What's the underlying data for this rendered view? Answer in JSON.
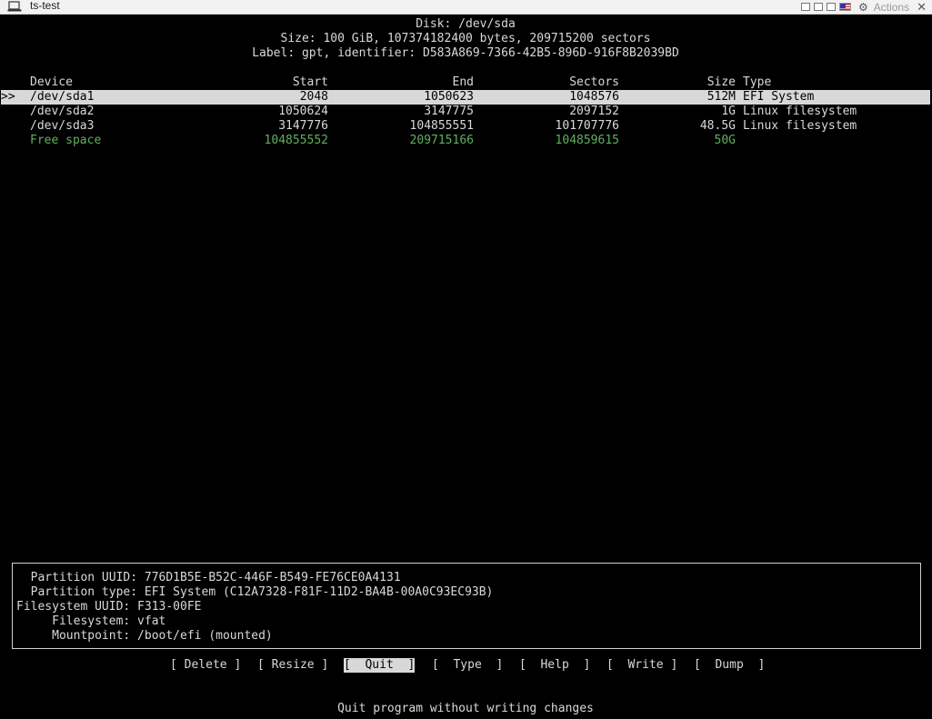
{
  "window": {
    "title": "ts-test",
    "actions_label": "Actions",
    "close_label": "✕"
  },
  "header": {
    "disk": "Disk: /dev/sda",
    "size": "Size: 100 GiB, 107374182400 bytes, 209715200 sectors",
    "label": "Label: gpt, identifier: D583A869-7366-42B5-896D-916F8B2039BD"
  },
  "table": {
    "columns": {
      "device": "Device",
      "start": "Start",
      "end": "End",
      "sectors": "Sectors",
      "size": "Size",
      "type": "Type"
    },
    "selection_marker": ">>",
    "rows": [
      {
        "device": "/dev/sda1",
        "start": "2048",
        "end": "1050623",
        "sectors": "1048576",
        "size": "512M",
        "type": "EFI System"
      },
      {
        "device": "/dev/sda2",
        "start": "1050624",
        "end": "3147775",
        "sectors": "2097152",
        "size": "1G",
        "type": "Linux filesystem"
      },
      {
        "device": "/dev/sda3",
        "start": "3147776",
        "end": "104855551",
        "sectors": "101707776",
        "size": "48.5G",
        "type": "Linux filesystem"
      },
      {
        "device": "Free space",
        "start": "104855552",
        "end": "209715166",
        "sectors": "104859615",
        "size": "50G",
        "type": ""
      }
    ]
  },
  "info": {
    "lines": [
      "  Partition UUID: 776D1B5E-B52C-446F-B549-FE76CE0A4131",
      "  Partition type: EFI System (C12A7328-F81F-11D2-BA4B-00A0C93EC93B)",
      "Filesystem UUID: F313-00FE",
      "     Filesystem: vfat",
      "     Mountpoint: /boot/efi (mounted)"
    ]
  },
  "menu": {
    "delete": "[ Delete ]",
    "resize": "[ Resize ]",
    "quit": "[  Quit  ]",
    "type": "[  Type  ]",
    "help": "[  Help  ]",
    "write": "[  Write ]",
    "dump": "[  Dump  ]"
  },
  "status": "Quit program without writing changes",
  "colors": {
    "background": "#000000",
    "text": "#d9d9d9",
    "selection": "#d8d8d8",
    "free_space": "#5fb15f"
  }
}
